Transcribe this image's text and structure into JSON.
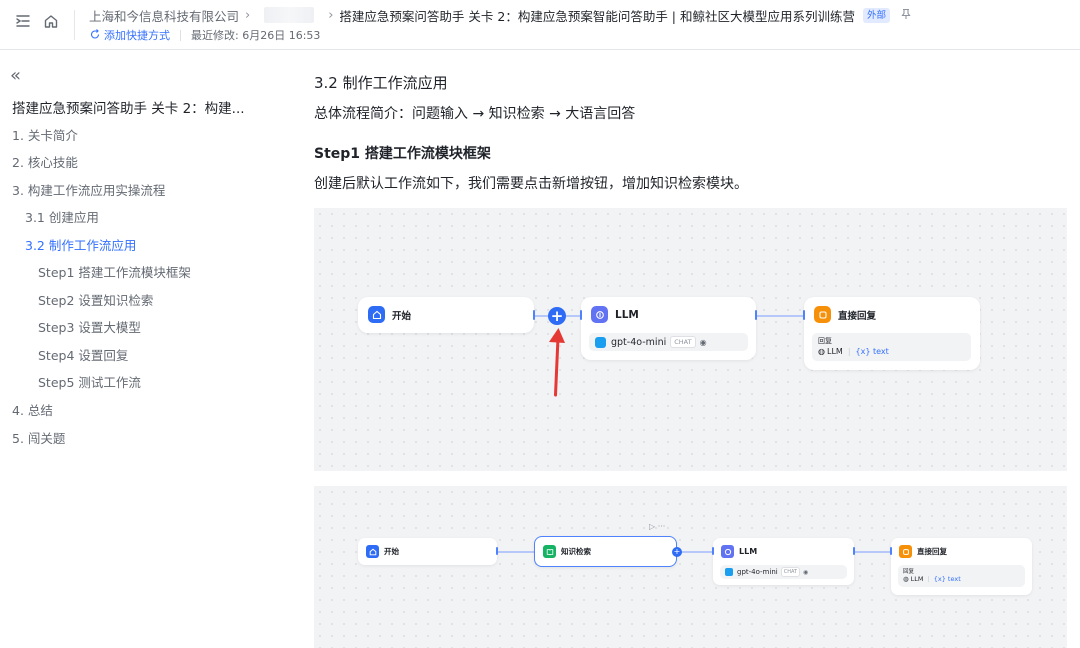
{
  "header": {
    "breadcrumb_company": "上海和今信息科技有限公司",
    "doc_title": "搭建应急预案问答助手 关卡 2：构建应急预案智能问答助手 | 和鲸社区大模型应用系列训练营",
    "external_tag": "外部",
    "add_shortcut": "添加快捷方式",
    "last_modified": "最近修改: 6月26日 16:53"
  },
  "toc": {
    "title": "搭建应急预案问答助手 关卡 2：构建...",
    "items": [
      {
        "label": "1. 关卡简介"
      },
      {
        "label": "2. 核心技能"
      },
      {
        "label": "3. 构建工作流应用实操流程"
      },
      {
        "label": "3.1 创建应用"
      },
      {
        "label": "3.2 制作工作流应用"
      },
      {
        "label": "Step1 搭建工作流模块框架"
      },
      {
        "label": "Step2 设置知识检索"
      },
      {
        "label": "Step3 设置大模型"
      },
      {
        "label": "Step4 设置回复"
      },
      {
        "label": "Step5 测试工作流"
      },
      {
        "label": "4. 总结"
      },
      {
        "label": "5. 闯关题"
      }
    ],
    "active_index": 4
  },
  "content": {
    "heading": "3.2 制作工作流应用",
    "overview": "总体流程简介：问题输入 → 知识检索 → 大语言回答",
    "step_heading": "Step1 搭建工作流模块框架",
    "step_text": "创建后默认工作流如下，我们需要点击新增按钮，增加知识检索模块。"
  },
  "workflow1": {
    "start": "开始",
    "llm": "LLM",
    "model": "gpt-4o-mini",
    "model_tag": "CHAT",
    "reply": "直接回复",
    "reply_label": "回复",
    "reply_source": "LLM",
    "reply_var": "{x} text"
  },
  "workflow2": {
    "start": "开始",
    "retrieval": "知识检索",
    "llm": "LLM",
    "model": "gpt-4o-mini",
    "model_tag": "CHAT",
    "reply": "直接回复",
    "reply_label": "回复",
    "reply_source": "LLM",
    "reply_var": "{x} text"
  },
  "colors": {
    "accent": "#3370ff",
    "start_icon": "#2e6cf6",
    "llm_icon": "#6172f3",
    "reply_icon": "#f79009",
    "retrieval_icon": "#16b364",
    "arrow": "#e53935"
  }
}
